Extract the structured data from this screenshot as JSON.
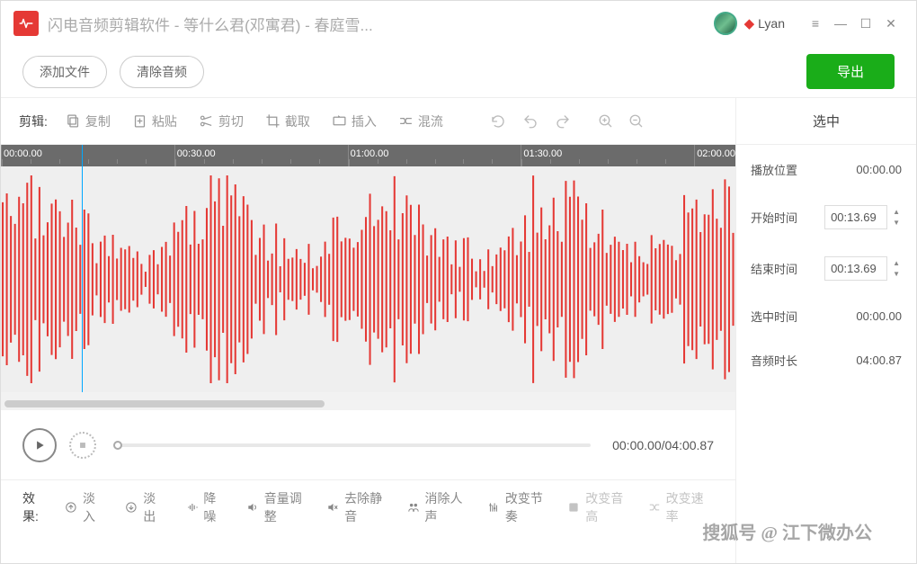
{
  "titlebar": {
    "app_name": "闪电音频剪辑软件",
    "file_info": " - 等什么君(邓寓君) - 春庭雪...",
    "username": "Lyan"
  },
  "toolbar": {
    "add_file": "添加文件",
    "clear_audio": "清除音频",
    "export": "导出"
  },
  "edit": {
    "label": "剪辑:",
    "copy": "复制",
    "paste": "粘贴",
    "cut": "剪切",
    "crop": "截取",
    "insert": "插入",
    "mix": "混流"
  },
  "ruler": {
    "t0": "00:00.00",
    "t1": "00:30.00",
    "t2": "01:00.00",
    "t3": "01:30.00",
    "t4": "02:00.00"
  },
  "playback": {
    "current": "00:00.00",
    "total": "04:00.87"
  },
  "effects": {
    "label": "效果:",
    "fade_in": "淡入",
    "fade_out": "淡出",
    "denoise": "降噪",
    "volume": "音量调整",
    "remove_silence": "去除静音",
    "remove_vocal": "消除人声",
    "change_tempo": "改变节奏",
    "change_pitch": "改变音高",
    "change_speed": "改变速率"
  },
  "right": {
    "header": "选中",
    "play_pos_label": "播放位置",
    "play_pos": "00:00.00",
    "start_label": "开始时间",
    "start": "00:13.69",
    "end_label": "结束时间",
    "end": "00:13.69",
    "selected_label": "选中时间",
    "selected": "00:00.00",
    "duration_label": "音频时长",
    "duration": "04:00.87"
  },
  "watermark": "搜狐号 @ 江下微办公"
}
